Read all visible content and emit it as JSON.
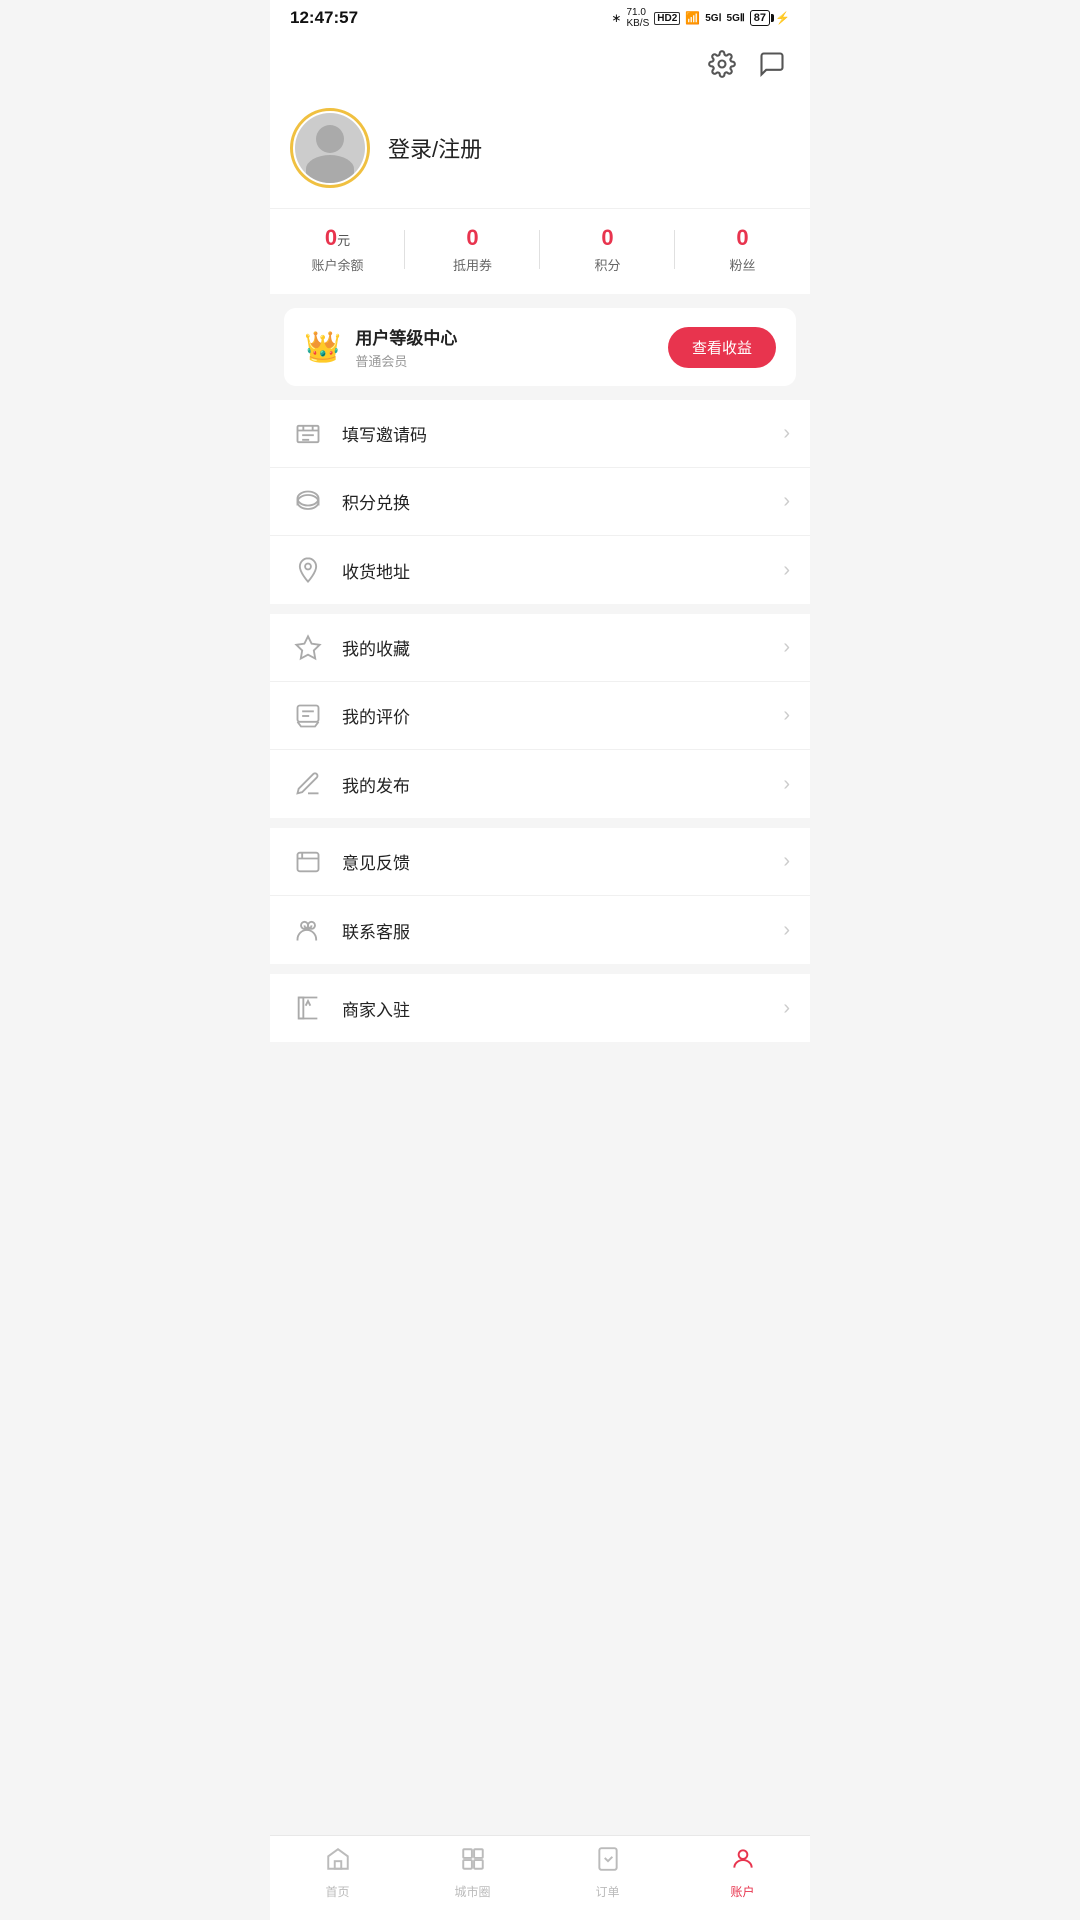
{
  "statusBar": {
    "time": "12:47:57",
    "battery": "87",
    "icons": "bluetooth signal wifi 5g"
  },
  "header": {
    "settingsLabel": "settings",
    "messageLabel": "message"
  },
  "profile": {
    "loginText": "登录/注册",
    "avatarAlt": "avatar"
  },
  "stats": [
    {
      "value": "0",
      "unit": "元",
      "label": "账户余额"
    },
    {
      "value": "0",
      "unit": "",
      "label": "抵用券"
    },
    {
      "value": "0",
      "unit": "",
      "label": "积分"
    },
    {
      "value": "0",
      "unit": "",
      "label": "粉丝"
    }
  ],
  "levelCard": {
    "title": "用户等级中心",
    "sub": "普通会员",
    "buttonLabel": "查看收益"
  },
  "menuGroups": [
    {
      "items": [
        {
          "id": "invite",
          "label": "填写邀请码"
        },
        {
          "id": "points",
          "label": "积分兑换"
        },
        {
          "id": "address",
          "label": "收货地址"
        }
      ]
    },
    {
      "items": [
        {
          "id": "favorites",
          "label": "我的收藏"
        },
        {
          "id": "reviews",
          "label": "我的评价"
        },
        {
          "id": "publish",
          "label": "我的发布"
        }
      ]
    },
    {
      "items": [
        {
          "id": "feedback",
          "label": "意见反馈"
        },
        {
          "id": "service",
          "label": "联系客服"
        }
      ]
    },
    {
      "items": [
        {
          "id": "merchant",
          "label": "商家入驻"
        }
      ]
    }
  ],
  "bottomNav": [
    {
      "id": "home",
      "label": "首页",
      "active": false
    },
    {
      "id": "city",
      "label": "城市圈",
      "active": false
    },
    {
      "id": "order",
      "label": "订单",
      "active": false
    },
    {
      "id": "account",
      "label": "账户",
      "active": true
    }
  ]
}
